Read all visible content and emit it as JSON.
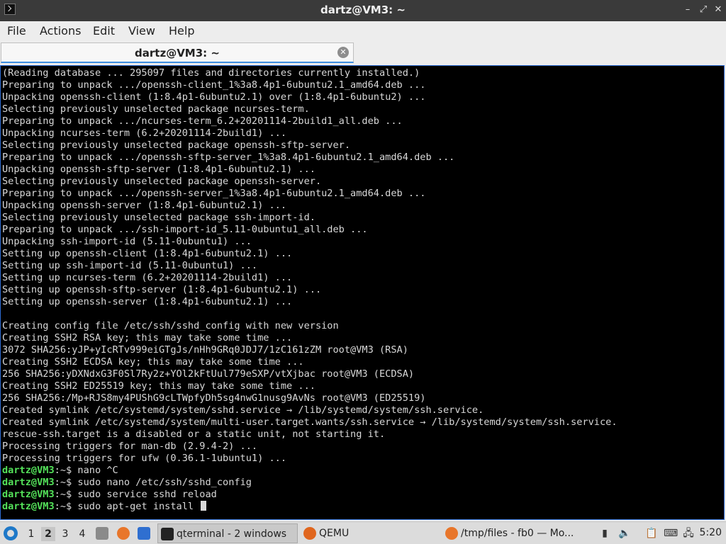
{
  "window": {
    "title": "dartz@VM3: ~",
    "minimize_glyph": "–",
    "maximize_glyph": "⤢",
    "close_glyph": "✕"
  },
  "menu": {
    "items": [
      "File",
      "Actions",
      "Edit",
      "View",
      "Help"
    ]
  },
  "tab": {
    "label": "dartz@VM3: ~",
    "close_glyph": "✕"
  },
  "terminal": {
    "lines": [
      "(Reading database ... 295097 files and directories currently installed.)",
      "Preparing to unpack .../openssh-client_1%3a8.4p1-6ubuntu2.1_amd64.deb ...",
      "Unpacking openssh-client (1:8.4p1-6ubuntu2.1) over (1:8.4p1-6ubuntu2) ...",
      "Selecting previously unselected package ncurses-term.",
      "Preparing to unpack .../ncurses-term_6.2+20201114-2build1_all.deb ...",
      "Unpacking ncurses-term (6.2+20201114-2build1) ...",
      "Selecting previously unselected package openssh-sftp-server.",
      "Preparing to unpack .../openssh-sftp-server_1%3a8.4p1-6ubuntu2.1_amd64.deb ...",
      "Unpacking openssh-sftp-server (1:8.4p1-6ubuntu2.1) ...",
      "Selecting previously unselected package openssh-server.",
      "Preparing to unpack .../openssh-server_1%3a8.4p1-6ubuntu2.1_amd64.deb ...",
      "Unpacking openssh-server (1:8.4p1-6ubuntu2.1) ...",
      "Selecting previously unselected package ssh-import-id.",
      "Preparing to unpack .../ssh-import-id_5.11-0ubuntu1_all.deb ...",
      "Unpacking ssh-import-id (5.11-0ubuntu1) ...",
      "Setting up openssh-client (1:8.4p1-6ubuntu2.1) ...",
      "Setting up ssh-import-id (5.11-0ubuntu1) ...",
      "Setting up ncurses-term (6.2+20201114-2build1) ...",
      "Setting up openssh-sftp-server (1:8.4p1-6ubuntu2.1) ...",
      "Setting up openssh-server (1:8.4p1-6ubuntu2.1) ...",
      "",
      "Creating config file /etc/ssh/sshd_config with new version",
      "Creating SSH2 RSA key; this may take some time ...",
      "3072 SHA256:yJP+yIcRTv999eiGTgJs/nHh9GRq0JDJ7/1zC161zZM root@VM3 (RSA)",
      "Creating SSH2 ECDSA key; this may take some time ...",
      "256 SHA256:yDXNdxG3F0Sl7Ry2z+YOl2kFtUul779eSXP/vtXjbac root@VM3 (ECDSA)",
      "Creating SSH2 ED25519 key; this may take some time ...",
      "256 SHA256:/Mp+RJS8my4PUShG9cLTWpfyDh5sg4nwG1nusg9AvNs root@VM3 (ED25519)",
      "Created symlink /etc/systemd/system/sshd.service → /lib/systemd/system/ssh.service.",
      "Created symlink /etc/systemd/system/multi-user.target.wants/ssh.service → /lib/systemd/system/ssh.service.",
      "rescue-ssh.target is a disabled or a static unit, not starting it.",
      "Processing triggers for man-db (2.9.4-2) ...",
      "Processing triggers for ufw (0.36.1-1ubuntu1) ..."
    ],
    "prompt_user": "dartz@VM3",
    "prompt_path": ":~$ ",
    "commands": [
      "nano ^C",
      "sudo nano /etc/ssh/sshd_config",
      "sudo service sshd reload",
      "sudo apt-get install "
    ]
  },
  "taskbar": {
    "workspaces": [
      "1",
      "2",
      "3",
      "4"
    ],
    "active_workspace": "2",
    "tasks": [
      {
        "label": "qterminal - 2 windows",
        "icon": "terminal-icon"
      },
      {
        "label": "QEMU",
        "icon": "qemu-icon"
      },
      {
        "label": "/tmp/files - fb0 — Mo...",
        "icon": "firefox-icon"
      }
    ],
    "clock": "5:20"
  },
  "colors": {
    "terminal_bg": "#000000",
    "terminal_fg": "#d8d8d8",
    "prompt_green": "#54e25a",
    "accent_blue": "#3d8ee0"
  }
}
